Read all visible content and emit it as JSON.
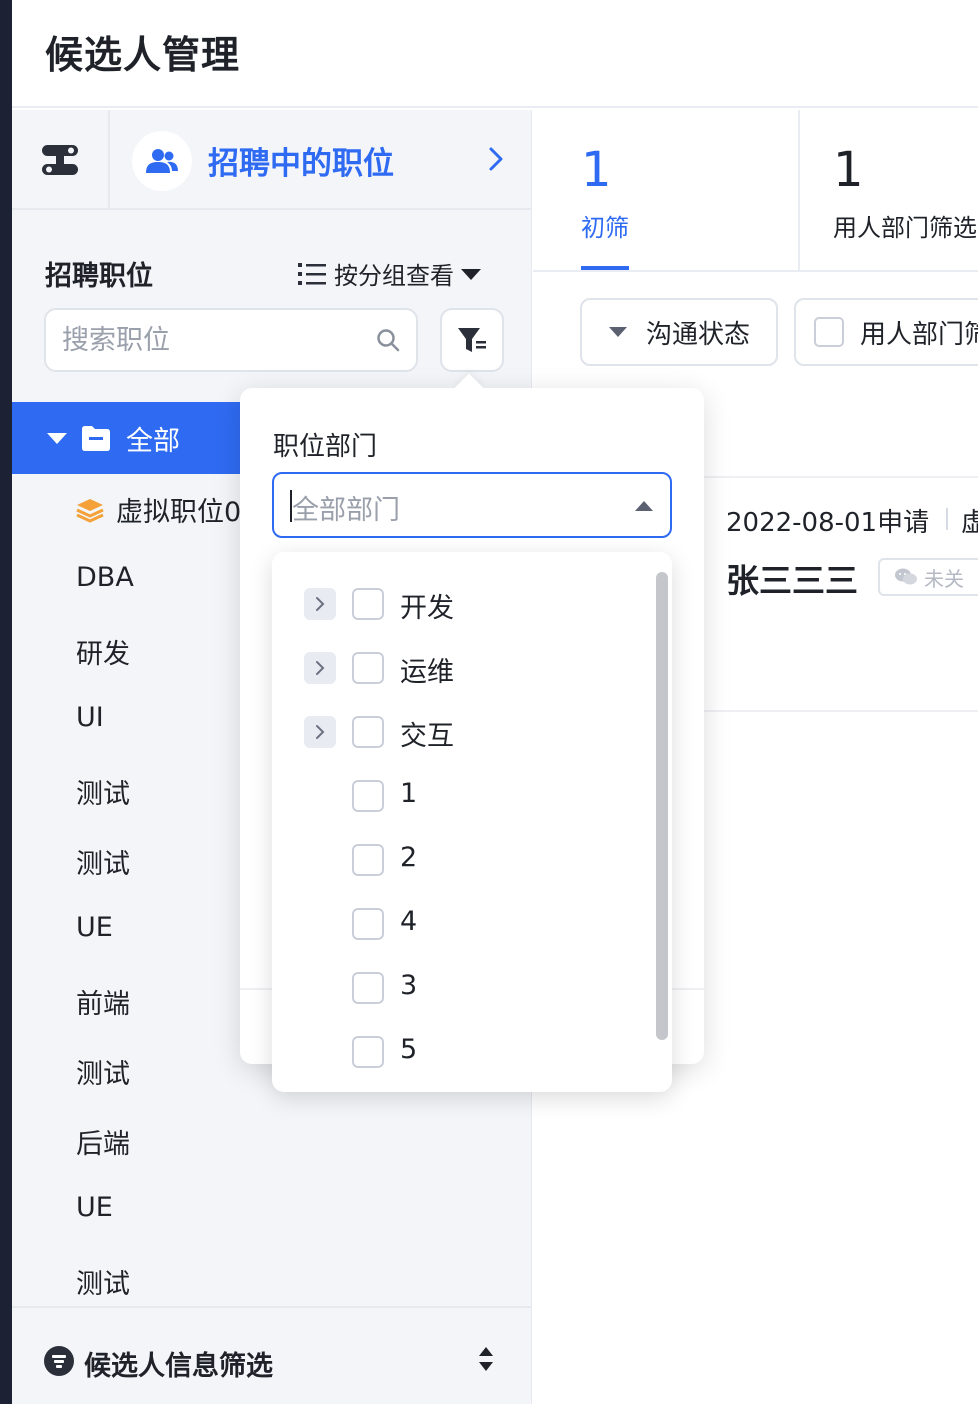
{
  "header": {
    "title": "候选人管理"
  },
  "sidebar": {
    "recruiting_link": "招聘中的职位",
    "section_title": "招聘职位",
    "group_view_label": "按分组查看",
    "search": {
      "placeholder": "搜索职位",
      "value": ""
    },
    "tree": {
      "root_label": "全部",
      "virtual_label": "虚拟职位0",
      "items": [
        "DBA",
        "研发",
        "UI",
        "测试",
        "测试",
        "UE",
        "前端",
        "测试",
        "后端",
        "UE",
        "测试"
      ]
    },
    "bottom_filter_label": "候选人信息筛选"
  },
  "stages": [
    {
      "count": "1",
      "label": "初筛",
      "active": true
    },
    {
      "count": "1",
      "label": "用人部门筛选",
      "active": false
    }
  ],
  "filters": {
    "communication_status": "沟通状态",
    "dept_filter": "用人部门筛选"
  },
  "candidate_card": {
    "applied": "2022-08-01申请",
    "tail": "虚",
    "name": "张三三三",
    "wechat_tag": "未关"
  },
  "popover": {
    "field_label": "职位部门",
    "select_placeholder": "全部部门",
    "options": [
      {
        "label": "开发",
        "expandable": true,
        "checked": false
      },
      {
        "label": "运维",
        "expandable": true,
        "checked": false
      },
      {
        "label": "交互",
        "expandable": true,
        "checked": false
      },
      {
        "label": "1",
        "expandable": false,
        "checked": false
      },
      {
        "label": "2",
        "expandable": false,
        "checked": false
      },
      {
        "label": "4",
        "expandable": false,
        "checked": false
      },
      {
        "label": "3",
        "expandable": false,
        "checked": false
      },
      {
        "label": "5",
        "expandable": false,
        "checked": false
      }
    ]
  },
  "colors": {
    "accent": "#2f6bf2",
    "sidebar_bg": "#f3f5f9",
    "strip": "#1c2133"
  }
}
